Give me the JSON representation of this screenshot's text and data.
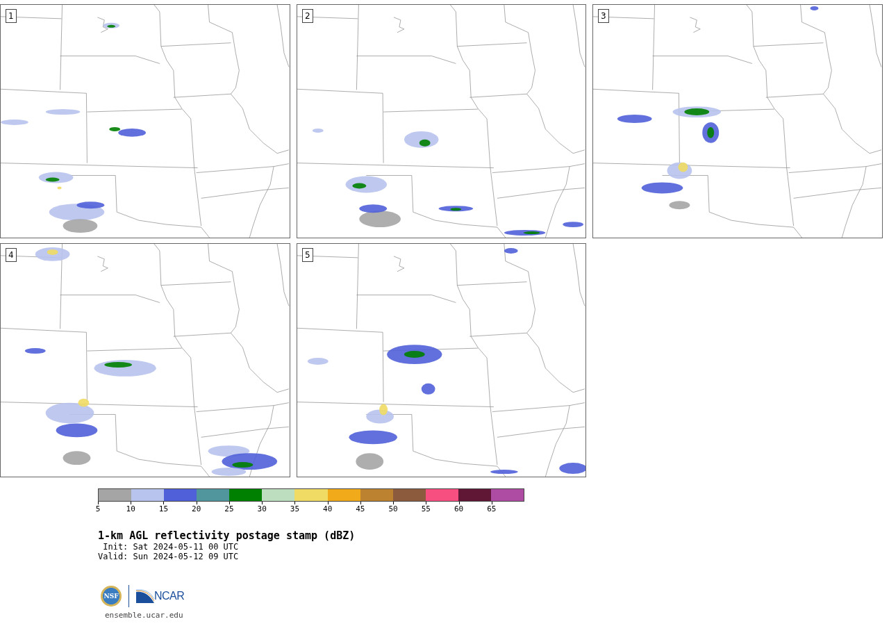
{
  "panels": [
    {
      "label": "1"
    },
    {
      "label": "2"
    },
    {
      "label": "3"
    },
    {
      "label": "4"
    },
    {
      "label": "5"
    }
  ],
  "colorbar": {
    "bins": [
      {
        "color": "#a5a5a5"
      },
      {
        "color": "#b8c3ee"
      },
      {
        "color": "#5060d8"
      },
      {
        "color": "#50969c"
      },
      {
        "color": "#008000"
      },
      {
        "color": "#bedfbf"
      },
      {
        "color": "#f0dc64"
      },
      {
        "color": "#f0aa1a"
      },
      {
        "color": "#bc8230"
      },
      {
        "color": "#8c5a3c"
      },
      {
        "color": "#f75080"
      },
      {
        "color": "#5f1735"
      },
      {
        "color": "#ae4ba2"
      }
    ],
    "ticks": [
      "5",
      "10",
      "15",
      "20",
      "25",
      "30",
      "35",
      "40",
      "45",
      "50",
      "55",
      "60",
      "65"
    ]
  },
  "title": "1-km AGL reflectivity postage stamp (dBZ)",
  "init": "Init: Sat 2024-05-11 00 UTC",
  "valid": "Valid: Sun 2024-05-12 09 UTC",
  "logos": {
    "nsf": "NSF",
    "ncar": "NCAR"
  },
  "url": "ensemble.ucar.edu"
}
